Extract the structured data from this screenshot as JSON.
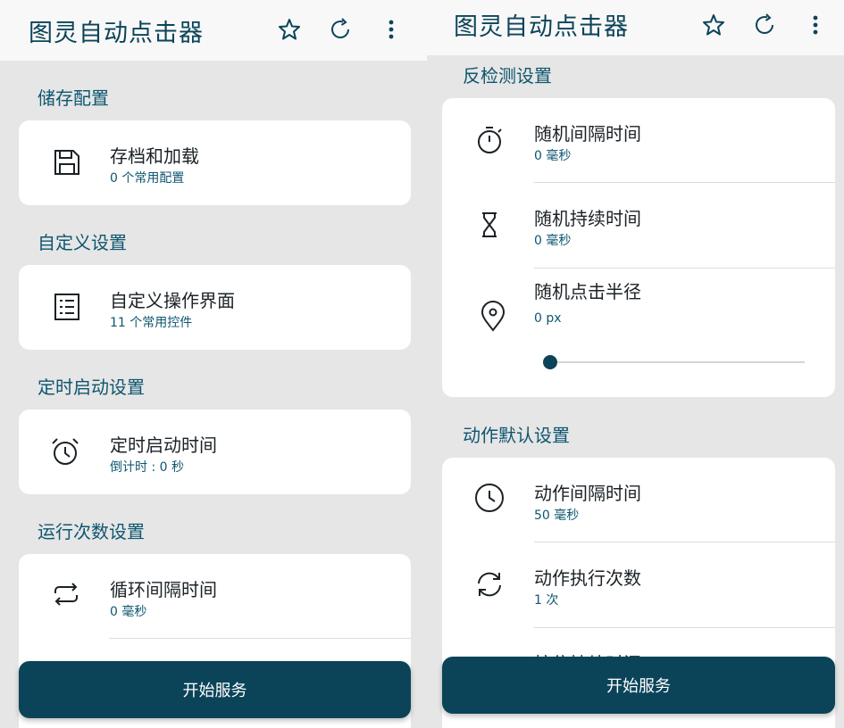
{
  "colors": {
    "accent": "#0b4459",
    "section": "#0f5670",
    "background": "#e6e6e6",
    "card": "#ffffff",
    "appbar": "#f8f8f8"
  },
  "left": {
    "app_title": "图灵自动点击器",
    "appbar_icons": [
      "star-icon",
      "refresh-icon",
      "more-vert-icon"
    ],
    "sections": [
      {
        "title": "储存配置",
        "rows": [
          {
            "icon": "save-icon",
            "title": "存档和加载",
            "subtitle": "0 个常用配置"
          }
        ]
      },
      {
        "title": "自定义设置",
        "rows": [
          {
            "icon": "list-icon",
            "title": "自定义操作界面",
            "subtitle": "11 个常用控件"
          }
        ]
      },
      {
        "title": "定时启动设置",
        "rows": [
          {
            "icon": "alarm-icon",
            "title": "定时启动时间",
            "subtitle": "倒计时 : 0 秒"
          }
        ]
      },
      {
        "title": "运行次数设置",
        "rows": [
          {
            "icon": "repeat-icon",
            "title": "循环间隔时间",
            "subtitle": "0 毫秒"
          }
        ]
      }
    ],
    "start_button": "开始服务"
  },
  "right": {
    "app_title": "图灵自动点击器",
    "appbar_icons": [
      "star-icon",
      "refresh-icon",
      "more-vert-icon"
    ],
    "sections": [
      {
        "title": "反检测设置",
        "rows": [
          {
            "icon": "timer-icon",
            "title": "随机间隔时间",
            "subtitle": "0 毫秒"
          },
          {
            "icon": "hourglass-icon",
            "title": "随机持续时间",
            "subtitle": "0 毫秒"
          },
          {
            "icon": "location-pin-icon",
            "title": "随机点击半径",
            "subtitle": "0 px",
            "slider_value": 0
          }
        ]
      },
      {
        "title": "动作默认设置",
        "rows": [
          {
            "icon": "clock-icon",
            "title": "动作间隔时间",
            "subtitle": "50 毫秒"
          },
          {
            "icon": "sync-icon",
            "title": "动作执行次数",
            "subtitle": "1 次"
          },
          {
            "icon": "hand-icon",
            "title": "按住持续时间",
            "subtitle": ""
          }
        ]
      }
    ],
    "start_button": "开始服务"
  }
}
